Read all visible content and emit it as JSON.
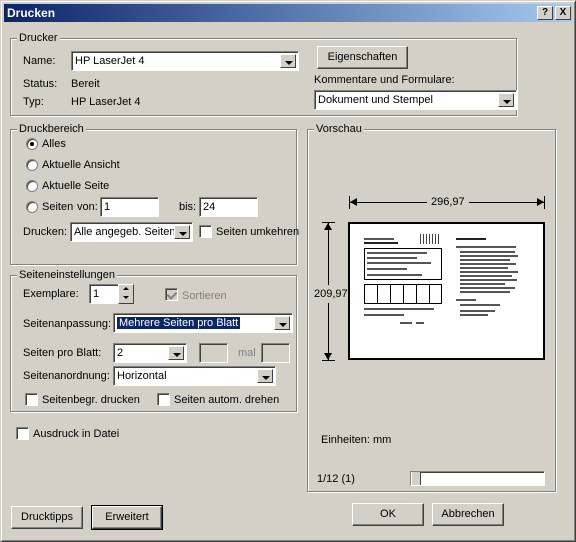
{
  "window": {
    "title": "Drucken",
    "help_glyph": "?",
    "close_glyph": "X"
  },
  "printer": {
    "legend": "Drucker",
    "name_label": "Name:",
    "name_value": "HP LaserJet 4",
    "status_label": "Status:",
    "status_value": "Bereit",
    "type_label": "Typ:",
    "type_value": "HP LaserJet 4",
    "properties_button": "Eigenschaften",
    "comments_label": "Kommentare und Formulare:",
    "comments_value": "Dokument und Stempel"
  },
  "print_range": {
    "legend": "Druckbereich",
    "options": [
      "Alles",
      "Aktuelle Ansicht",
      "Aktuelle Seite",
      "Seiten"
    ],
    "selected": "Alles",
    "from_label": "von:",
    "from_value": "1",
    "to_label": "bis:",
    "to_value": "24",
    "print_label": "Drucken:",
    "print_value": "Alle angegeb. Seiten",
    "reverse_label": "Seiten umkehren"
  },
  "page_setup": {
    "legend": "Seiteneinstellungen",
    "copies_label": "Exemplare:",
    "copies_value": "1",
    "collate_label": "Sortieren",
    "scaling_label": "Seitenanpassung:",
    "scaling_value": "Mehrere Seiten pro Blatt",
    "pages_per_sheet_label": "Seiten pro Blatt:",
    "pages_per_sheet_value": "2",
    "times_label": "mal",
    "order_label": "Seitenanordnung:",
    "order_value": "Horizontal",
    "borders_label": "Seitenbegr. drucken",
    "autorotate_label": "Seiten autom. drehen"
  },
  "print_to_file_label": "Ausdruck in Datei",
  "preview": {
    "legend": "Vorschau",
    "width": "296,97",
    "height": "209,97",
    "units": "Einheiten: mm",
    "page_counter": "1/12 (1)",
    "slider_position": 0
  },
  "buttons": {
    "tips": "Drucktipps",
    "advanced": "Erweitert",
    "ok": "OK",
    "cancel": "Abbrechen"
  }
}
